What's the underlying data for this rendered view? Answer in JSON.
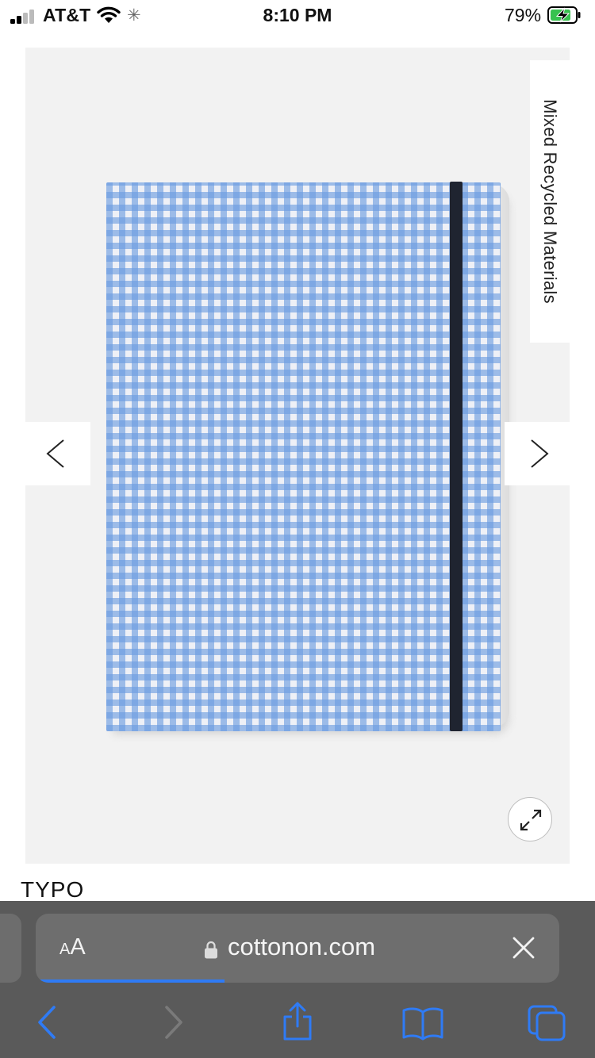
{
  "status_bar": {
    "carrier": "AT&T",
    "time": "8:10 PM",
    "battery_percent": "79%"
  },
  "product": {
    "badge": "Mixed Recycled Materials",
    "brand": "TYPO",
    "pattern": "blue gingham",
    "gallery_controls": {
      "prev_icon": "chevron-left-icon",
      "next_icon": "chevron-right-icon",
      "expand_icon": "expand-icon"
    }
  },
  "browser": {
    "text_size_small": "A",
    "text_size_large": "A",
    "url": "cottonon.com",
    "load_progress": 0.36,
    "toolbar_icons": [
      "back-icon",
      "forward-icon",
      "share-icon",
      "bookmarks-icon",
      "tabs-icon"
    ]
  },
  "colors": {
    "gingham_blue": "#6a9be0",
    "strap": "#1f2430",
    "accent_blue": "#2f7bf5",
    "toolbar_bg": "#5a5a5a"
  }
}
